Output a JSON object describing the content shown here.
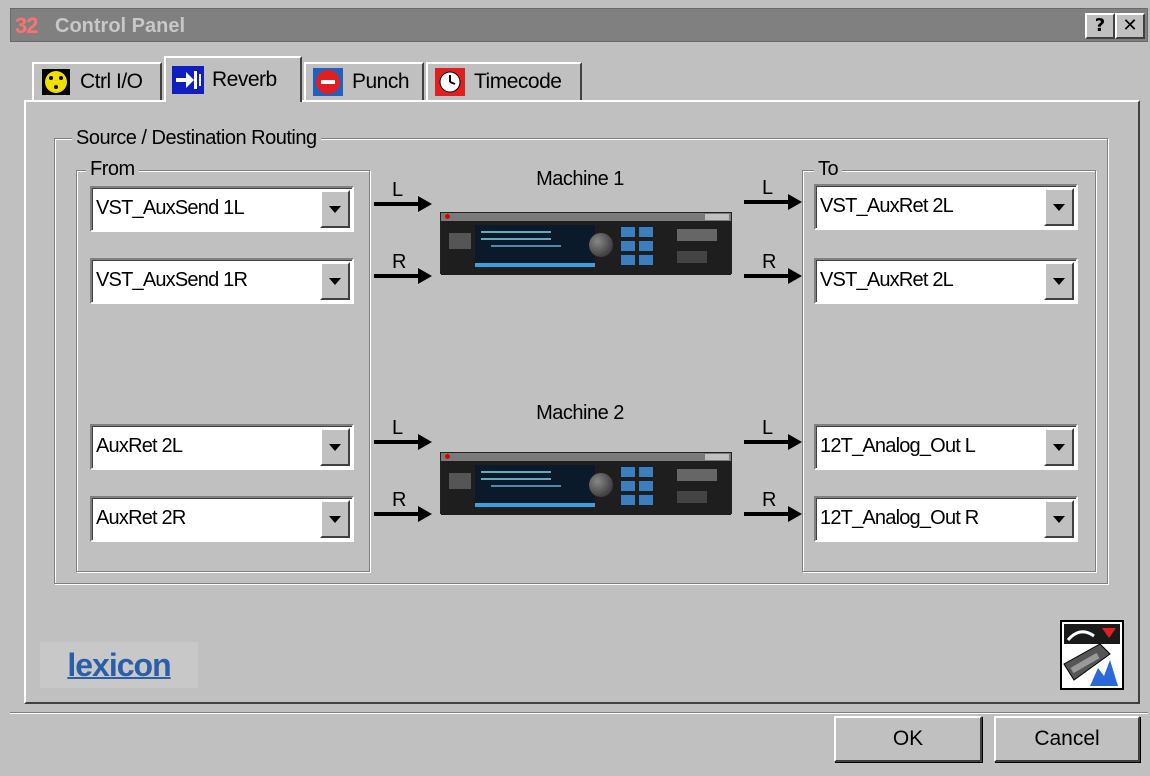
{
  "window": {
    "icon_glyph": "32",
    "title": "Control Panel",
    "help_label": "?",
    "close_label": "✕"
  },
  "tabs": [
    {
      "label": "Ctrl I/O",
      "icon": "ctrl-io-icon",
      "active": false
    },
    {
      "label": "Reverb",
      "icon": "reverb-icon",
      "active": true
    },
    {
      "label": "Punch",
      "icon": "punch-icon",
      "active": false
    },
    {
      "label": "Timecode",
      "icon": "timecode-icon",
      "active": false
    }
  ],
  "routing": {
    "group_label": "Source / Destination Routing",
    "from_label": "From",
    "to_label": "To",
    "channel_left": "L",
    "channel_right": "R",
    "machines": [
      {
        "label": "Machine 1",
        "from": [
          "VST_AuxSend 1L",
          "VST_AuxSend 1R"
        ],
        "to": [
          "VST_AuxRet 2L",
          "VST_AuxRet 2L"
        ]
      },
      {
        "label": "Machine 2",
        "from": [
          "AuxRet 2L",
          "AuxRet 2R"
        ],
        "to": [
          "12T_Analog_Out L",
          "12T_Analog_Out R"
        ]
      }
    ]
  },
  "brand": "lexicon",
  "buttons": {
    "ok": "OK",
    "cancel": "Cancel"
  },
  "colors": {
    "dialog_bg": "#c0c0c0",
    "titlebar_inactive": "#808080",
    "brand_blue": "#2a5ea8",
    "rack_accent": "#3aa0e0"
  }
}
